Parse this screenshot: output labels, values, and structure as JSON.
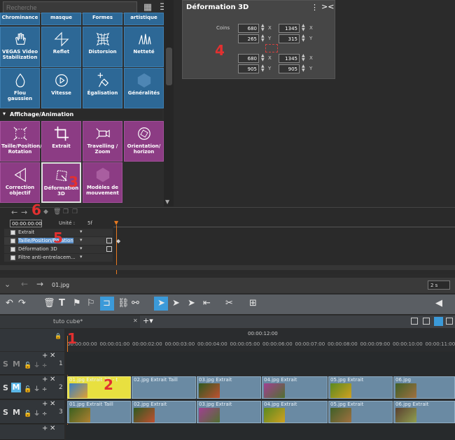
{
  "effects_panel": {
    "search_placeholder": "Recherche",
    "top_row": [
      "Chrominance",
      "",
      "Formes",
      "artistique"
    ],
    "top_row_split": [
      "",
      "masque"
    ],
    "row1": [
      "VEGAS Video Stabilization",
      "Reflet",
      "Distorsion",
      "Netteté"
    ],
    "row2": [
      "Flou gaussien",
      "Vitesse",
      "Égalisation",
      "Généralités"
    ],
    "category_label": "Affichage/Animation",
    "row3": [
      "Taille/Position/ Rotation",
      "Extrait",
      "Travelling / Zoom",
      "Orientation/ horizon"
    ],
    "row4": [
      "Correction objectif",
      "Déformation 3D",
      "Modèles de mouvement"
    ]
  },
  "deformation_panel": {
    "title": "Déformation 3D",
    "coins_label": "Coins",
    "tl_x": "680",
    "tl_y": "265",
    "tr_x": "1345",
    "tr_y": "315",
    "bl_x": "680",
    "bl_y": "905",
    "br_x": "1345",
    "br_y": "905",
    "x_label": "X",
    "y_label": "Y"
  },
  "keyframe_area": {
    "timecode": "00:00:00:00",
    "unit_label": "Unité :",
    "unit_value": "5f",
    "rows": [
      "Extrait",
      "Taille/Position/Rotation",
      "Déformation 3D",
      "Filtre anti-entrelacem..."
    ]
  },
  "timeline": {
    "file_name": "01.jpg",
    "duration": "2 s",
    "tab_name": "tuto cube*",
    "ruler_timecode": "00:00:12:00",
    "ruler_ticks": [
      "00:00:00:00",
      "00:00:01:00",
      "00:00:02:00",
      "00:00:03:00",
      "00:00:04:00",
      "00:00:05:00",
      "00:00:06:00",
      "00:00:07:00",
      "00:00:08:00",
      "00:00:09:00",
      "00:00:10:00",
      "00:00:11:00"
    ],
    "track_numbers": [
      "1",
      "2",
      "3"
    ],
    "track2_clips": [
      "01.jpg  Extrait 3D - t",
      "02.jpg  Extrait  Taill",
      "03.jpg  Extrait",
      "04.jpg  Extrait",
      "05.jpg  Extrait",
      "06.jpg"
    ],
    "track3_clips": [
      "01.jpg  Extrait  Taill",
      "02.jpg  Extrait",
      "03.jpg  Extrait",
      "04.jpg  Extrait",
      "05.jpg  Extrait",
      "06.jpg  Extrait"
    ],
    "track_letters": {
      "s": "S",
      "m": "M"
    }
  },
  "annotations": [
    "1",
    "2",
    "3",
    "4",
    "5",
    "6"
  ],
  "colors": {
    "blue_tile": "#2d6896",
    "purple_tile": "#8c3c84",
    "clip": "#6a8aa3",
    "selected_clip": "#e8e040",
    "playhead": "#e87a20",
    "annotation": "#e23030"
  }
}
